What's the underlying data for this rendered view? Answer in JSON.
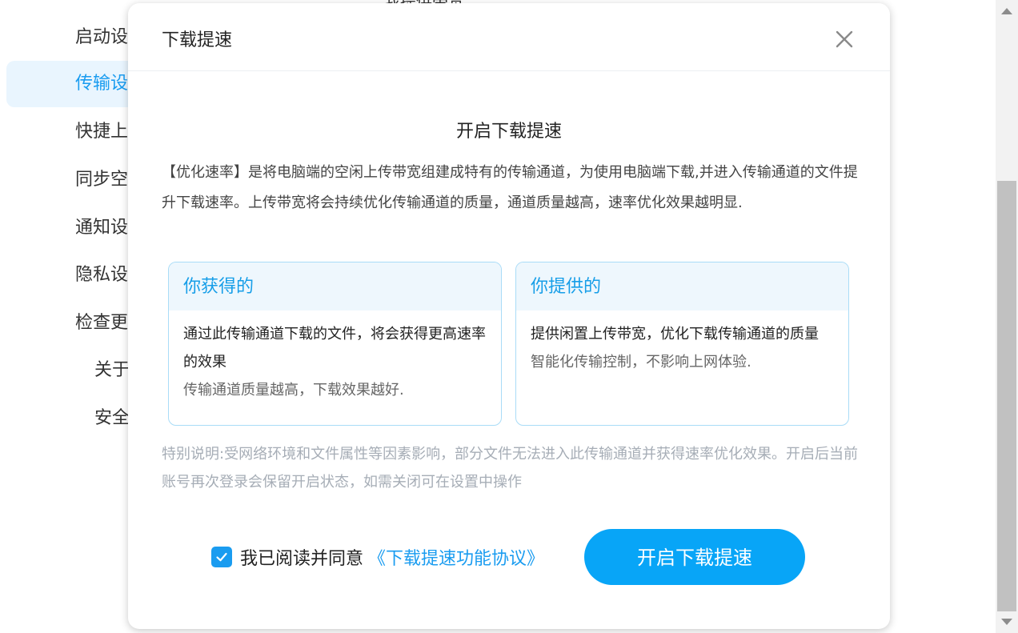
{
  "background": {
    "top_peek": "我提供带宽",
    "sidebar": {
      "items": [
        {
          "label": "启动设置"
        },
        {
          "label": "传输设置",
          "active": true
        },
        {
          "label": "快捷上传"
        },
        {
          "label": "同步空间"
        },
        {
          "label": "通知设置"
        },
        {
          "label": "隐私设置"
        },
        {
          "label": "检查更新"
        }
      ],
      "sub_items": [
        {
          "label": "关于"
        },
        {
          "label": "安全"
        }
      ]
    }
  },
  "dialog": {
    "title": "下载提速",
    "close_icon": "close-icon",
    "section_title": "开启下载提速",
    "intro": "【优化速率】是将电脑端的空闲上传带宽组建成特有的传输通道，为使用电脑端下载,并进入传输通道的文件提升下载速率。上传带宽将会持续优化传输通道的质量，通道质量越高，速率优化效果越明显.",
    "cards": [
      {
        "title": "你获得的",
        "main": "通过此传输通道下载的文件，将会获得更高速率的效果",
        "sub": "传输通道质量越高，下载效果越好."
      },
      {
        "title": "你提供的",
        "main": "提供闲置上传带宽，优化下载传输通道的质量",
        "sub": "智能化传输控制，不影响上网体验."
      }
    ],
    "note": "特别说明:受网络环境和文件属性等因素影响，部分文件无法进入此传输通道并获得速率优化效果。开启后当前账号再次登录会保留开启状态，如需关闭可在设置中操作",
    "agree": {
      "checked": true,
      "text": "我已阅读并同意",
      "link": "《下载提速功能协议》"
    },
    "primary_button": "开启下载提速"
  },
  "colors": {
    "accent": "#1a9cf0",
    "button": "#08a5f7",
    "card_border": "#a9dcf7",
    "card_head_bg": "#eef7fd",
    "sidebar_active_bg": "#e9f5fe"
  }
}
